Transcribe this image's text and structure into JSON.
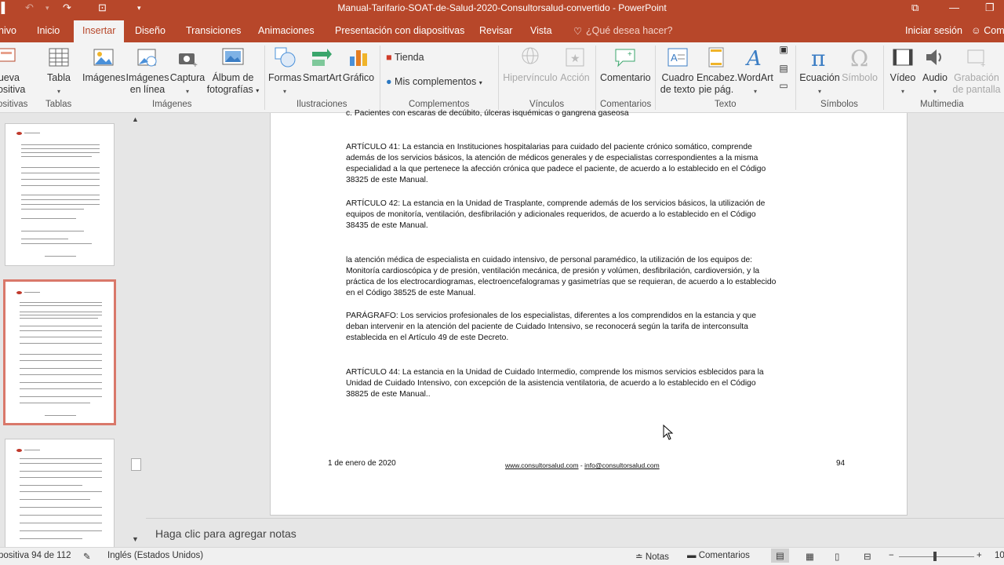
{
  "window": {
    "title": "Manual-Tarifario-SOAT-de-Salud-2020-Consultorsalud-convertido  -  PowerPoint"
  },
  "tabs": [
    "nivo",
    "Inicio",
    "Insertar",
    "Diseño",
    "Transiciones",
    "Animaciones",
    "Presentación con diapositivas",
    "Revisar",
    "Vista"
  ],
  "tell_me": "¿Qué desea hacer?",
  "signin": "Iniciar sesión",
  "share": "Com",
  "ribbon": {
    "nueva": [
      "lueva",
      "positiva"
    ],
    "tabla": "Tabla",
    "imagenes": "Imágenes",
    "imagenes_linea": [
      "Imágenes",
      "en línea"
    ],
    "captura": "Captura",
    "album": [
      "Álbum de",
      "fotografías"
    ],
    "formas": "Formas",
    "smartart": "SmartArt",
    "grafico": "Gráfico",
    "tienda": "Tienda",
    "mis_complementos": "Mis complementos",
    "hipervinculo": "Hipervínculo",
    "accion": "Acción",
    "comentario": "Comentario",
    "cuadro": [
      "Cuadro",
      "de texto"
    ],
    "encabez": [
      "Encabez.",
      "pie pág."
    ],
    "wordart": "WordArt",
    "ecuacion": "Ecuación",
    "simbolo": "Símbolo",
    "video": "Vídeo",
    "audio": "Audio",
    "grabacion": [
      "Grabación",
      "de pantalla"
    ],
    "groups": {
      "diapositivas": "ositivas",
      "tablas": "Tablas",
      "imagenes": "Imágenes",
      "ilustraciones": "Ilustraciones",
      "complementos": "Complementos",
      "vinculos": "Vínculos",
      "comentarios": "Comentarios",
      "texto": "Texto",
      "simbolos": "Símbolos",
      "multimedia": "Multimedia"
    }
  },
  "slide": {
    "top_line": "c.  Pacientes con escaras de decúbito, úlceras isquémicas o gangrena gaseosa",
    "p1": "ARTÍCULO 41: La estancia en Instituciones hospitalarias para cuidado del paciente crónico somático, comprende además de los servicios básicos, la atención de médicos generales y de especialistas correspondientes a la misma especialidad a la que pertenece la afección crónica que padece el paciente, de acuerdo a lo establecido en el Código 38325 de este Manual.",
    "p2": "ARTÍCULO 42: La estancia en la Unidad de Trasplante, comprende además de los servicios básicos, la utilización de equipos de monitoría, ventilación, desfibrilación y adicionales requeridos, de acuerdo a lo establecido en el Código 38435 de este Manual.",
    "p3": "la atención médica de especialista en cuidado intensivo, de personal paramédico, la utilización de los equipos de: Monitoría cardioscópica y de presión, ventilación mecánica, de presión y volúmen, desfibrilación, cardioversión, y la práctica de los electrocardiogramas, electroencefalogramas y gasimetrías que se requieran, de acuerdo a lo establecido en el Código 38525 de este Manual.",
    "p4": "PARÁGRAFO: Los servicios profesionales de los especialistas, diferentes a los comprendidos en la estancia y que deban intervenir en la atención del paciente de Cuidado Intensivo, se reconocerá según la tarifa de interconsulta establecida en el Artículo 49 de este Decreto.",
    "p5": "ARTÍCULO 44: La estancia en la Unidad de Cuidado Intermedio, comprende los mismos servicios esblecidos para la Unidad de Cuidado Intensivo, con excepción de la asistencia ventilatoria, de acuerdo a lo establecido en el Código 38825 de este Manual..",
    "footer_date": "1 de enero de 2020",
    "footer_link1": "www.consultorsalud.com",
    "footer_sep": " - ",
    "footer_link2": "info@consultorsalud.com",
    "footer_page": "94"
  },
  "notes_placeholder": "Haga clic para agregar notas",
  "status": {
    "slide_info": "positiva 94 de 112",
    "language": "Inglés (Estados Unidos)",
    "notes": "Notas",
    "comments": "Comentarios",
    "zoom": "10"
  },
  "colors": {
    "accent": "#b7472a",
    "selected_thumb": "#d9786a"
  }
}
